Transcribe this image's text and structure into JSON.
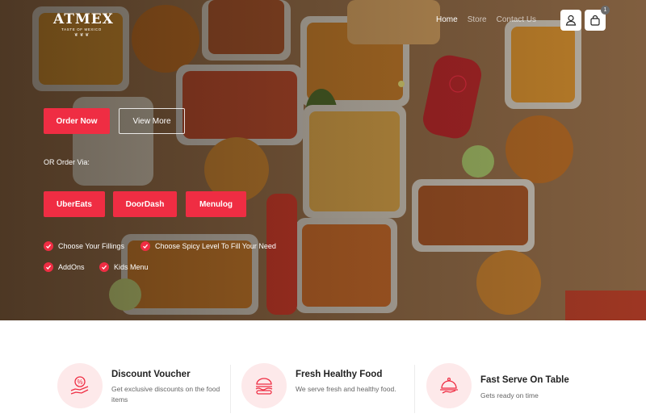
{
  "brand": {
    "name": "ATMEX",
    "tagline": "TASTE OF MEXICO",
    "ornament": "❦ ❦ ❦"
  },
  "nav": {
    "items": [
      {
        "label": "Home",
        "active": true
      },
      {
        "label": "Store",
        "active": false
      },
      {
        "label": "Contact Us",
        "active": false
      }
    ]
  },
  "header": {
    "account_icon": "user-icon",
    "cart_icon": "shopping-bag-icon",
    "cart_count": "1"
  },
  "hero": {
    "order_now": "Order Now",
    "view_more": "View More",
    "order_via_label": "OR Order Via:",
    "delivery": [
      "UberEats",
      "DoorDash",
      "Menulog"
    ],
    "features": [
      "Choose Your Fillings",
      "Choose Spicy Level To Fill Your Need",
      "AddOns",
      "Kids Menu"
    ]
  },
  "services": [
    {
      "title": "Discount Voucher",
      "text": "Get exclusive discounts on the food items",
      "icon": "discount-hand-icon"
    },
    {
      "title": "Fresh Healthy Food",
      "text": "We serve fresh and healthy food.",
      "icon": "burger-icon"
    },
    {
      "title": "Fast Serve On Table",
      "text": "Gets ready on time",
      "icon": "cloche-serving-icon"
    }
  ],
  "colors": {
    "accent": "#ef2d43",
    "accent_soft": "#fde9ea",
    "hero_bg": "#7a5a3c"
  }
}
